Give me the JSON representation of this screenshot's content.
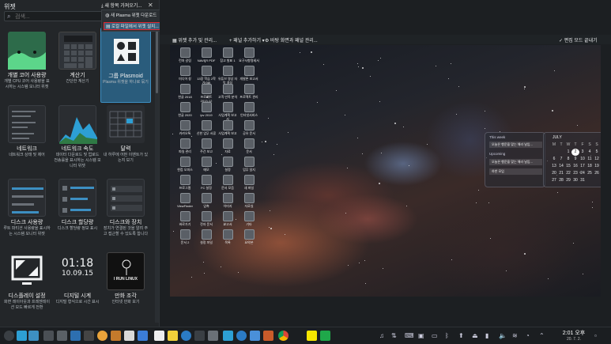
{
  "panel": {
    "title": "위젯",
    "search_placeholder": "검색...",
    "tiles": [
      {
        "name": "개별 코어 사용량",
        "desc": "개별 CPU 코어 사용량을 표시하는 시스템 모니터 위젯"
      },
      {
        "name": "계산기",
        "desc": "간단한 계산기"
      },
      {
        "name": "그룹 Plasmoid",
        "desc": "Plasma 위젯을 하나로 묶기"
      },
      {
        "name": "네트워크",
        "desc": "네트워크 상태 및 제어"
      },
      {
        "name": "네트워크 속도",
        "desc": "데이터 다운로드 및 업로드 전송률을 표시하는 시스템 모니터 위젯"
      },
      {
        "name": "달력",
        "desc": "내 하루에 어떤 이벤트가 있는지 보기"
      },
      {
        "name": "디스크 사용량",
        "desc": "루트 파티션 사용량을 표시하는 시스템 모니터 위젯"
      },
      {
        "name": "디스크 할당량",
        "desc": "디스크 할당량 정보 표시"
      },
      {
        "name": "디스크와 장치",
        "desc": "장치가 연결된 것을 알려 주고 접근할 수 있도록 합니다"
      },
      {
        "name": "디스플레이 설정",
        "desc": "화면 레이아웃과 프레젠테이션 모드 빠르게 전환"
      },
      {
        "name": "디지털 시계",
        "desc": "디지털 형식으로 시간 표시"
      },
      {
        "name": "만화 조각",
        "desc": "인터넷 만화 보기"
      }
    ],
    "clock_preview": {
      "time": "01:18",
      "date": "10.09.15"
    },
    "comic_preview": "I RUN LINUX"
  },
  "menu": {
    "header": "새 항목 가져오기...",
    "items": [
      {
        "label": "새 Plasma 위젯 다운로드"
      },
      {
        "label": "로컬 파일에서 위젯 설치..."
      }
    ]
  },
  "toolbar": {
    "add_widget": "위젯 추가 및 관리...",
    "add_panel": "패널 추가하기",
    "desktop_panel": "바탕 화면과 패널 관리...",
    "edit_done": "편집 모드 끝내기"
  },
  "desktop_icons": [
    "런처 갈림",
    "NAVER PDF",
    "참고 발표 1",
    "요구사항명세서",
    "미디어 창",
    "13장 학습 2학기(08)",
    "유튜브 영상 자막 생성",
    "개발론 보고서",
    "한글 2018",
    "프로젝트 2013-12",
    "고객 만족 분석",
    "프로젝트 관리",
    "한글 2020",
    "ipv 2019",
    "사업계획 보고서",
    "인터넷서비스",
    "카카오톡",
    "신한 업무 서류",
    "사업계획 보고",
    "공유 문서",
    "파일 관리",
    "주간 보고",
    "자료",
    "문서",
    "한컴 오피스",
    "메모",
    "설정",
    "업무 일지",
    "프로그램",
    "FC 설정",
    "문서 모음",
    "새 파일",
    "ViewFinder",
    "압축",
    "이미지",
    "자료실",
    "바로가기",
    "전자 문서",
    "보고서",
    "기타",
    "문서 2",
    "설정 파일",
    "목록",
    "요약본"
  ],
  "events_widget": {
    "this_week": "This week",
    "event1": "오늘은 행운을 맞는 해라 날입...",
    "upcoming": "Upcoming",
    "event2": "오늘은 행운을 맞는 해라 날입...",
    "event3": "하반 모임"
  },
  "calendar_widget": {
    "month": "JULY",
    "days": [
      "M",
      "T",
      "W",
      "T",
      "F",
      "S",
      "S"
    ],
    "weeks": [
      [
        "",
        "",
        "1",
        "2",
        "3",
        "4",
        "5"
      ],
      [
        "6",
        "7",
        "8",
        "9",
        "10",
        "11",
        "12"
      ],
      [
        "13",
        "14",
        "15",
        "16",
        "17",
        "18",
        "19"
      ],
      [
        "20",
        "21",
        "22",
        "23",
        "24",
        "25",
        "26"
      ],
      [
        "27",
        "28",
        "29",
        "30",
        "31",
        "",
        ""
      ]
    ],
    "today": "2"
  },
  "taskbar": {
    "time": "2:01 오후",
    "date": "20. 7. 2."
  }
}
